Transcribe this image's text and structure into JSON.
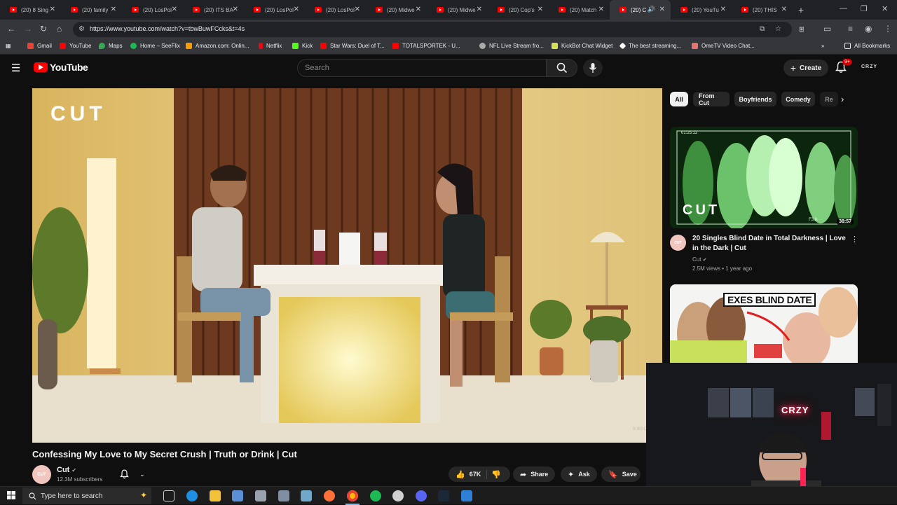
{
  "browser": {
    "tabs": [
      {
        "title": "(20) 8 Sing"
      },
      {
        "title": "(20) family"
      },
      {
        "title": "(20) LosPol"
      },
      {
        "title": "(20) ITS BA"
      },
      {
        "title": "(20) LosPol"
      },
      {
        "title": "(20) LosPol"
      },
      {
        "title": "(20) Midwe"
      },
      {
        "title": "(20) Midwe"
      },
      {
        "title": "(20) Cop's"
      },
      {
        "title": "(20) Match"
      },
      {
        "title": "(20) Co"
      },
      {
        "title": "(20) YouTu"
      },
      {
        "title": "(20) THIS"
      }
    ],
    "url": "https://www.youtube.com/watch?v=tbwBuwFCcks&t=4s",
    "bookmarks": [
      {
        "label": "Gmail",
        "color": "#ea4335"
      },
      {
        "label": "YouTube",
        "color": "#ff0000"
      },
      {
        "label": "Maps",
        "color": "#34a853"
      },
      {
        "label": "Home – SeeFlix",
        "color": "#1db954"
      },
      {
        "label": "Amazon.com: Onlin...",
        "color": "#ff9900"
      },
      {
        "label": "Netflix",
        "color": "#e50914"
      },
      {
        "label": "Kick",
        "color": "#53fc18"
      },
      {
        "label": "Star Wars: Duel of T...",
        "color": "#ff0000"
      },
      {
        "label": "TOTALSPORTEK - U...",
        "color": "#ff0000"
      },
      {
        "label": "NFL Live Stream fro...",
        "color": "#aaaaaa"
      },
      {
        "label": "KickBot Chat Widget",
        "color": "#d4e157"
      },
      {
        "label": "The best streaming...",
        "color": "#ffffff"
      },
      {
        "label": "OmeTV Video Chat...",
        "color": "#e57373"
      }
    ],
    "all_bookmarks": "All Bookmarks"
  },
  "youtube": {
    "logo_text": "YouTube",
    "search_placeholder": "Search",
    "create_label": "Create",
    "notif_badge": "9+",
    "account_label": "CRZY",
    "video": {
      "watermark": "CUT",
      "corner_mark": "SUBSC",
      "title": "Confessing My Love to My Secret Crush | Truth or Drink | Cut",
      "channel": "Cut",
      "channel_avatar_text": "CUT",
      "subscribers": "12.3M subscribers",
      "likes": "67K",
      "share_label": "Share",
      "ask_label": "Ask",
      "save_label": "Save"
    },
    "chips": [
      "All",
      "From Cut",
      "Boyfriends",
      "Comedy",
      "Re"
    ],
    "recommendations": [
      {
        "title": "20 Singles Blind Date in Total Darkness | Love in the Dark | Cut",
        "channel": "Cut",
        "meta": "2.5M views • 1 year ago",
        "duration": "38:57",
        "thumb_logo": "CUT",
        "thumb_timestamp": "01:25:12",
        "thumb_rec": "F3.8",
        "avatar_text": "CUT"
      },
      {
        "thumb_text": "EXES BLIND DATE"
      }
    ]
  },
  "webcam": {
    "neon_sign": "CRZY"
  },
  "taskbar": {
    "search_placeholder": "Type here to search"
  },
  "colors": {
    "yt_red": "#ff0000",
    "bg": "#0f0f0f",
    "chip_bg": "#272727",
    "neon": "#ff2a55"
  }
}
